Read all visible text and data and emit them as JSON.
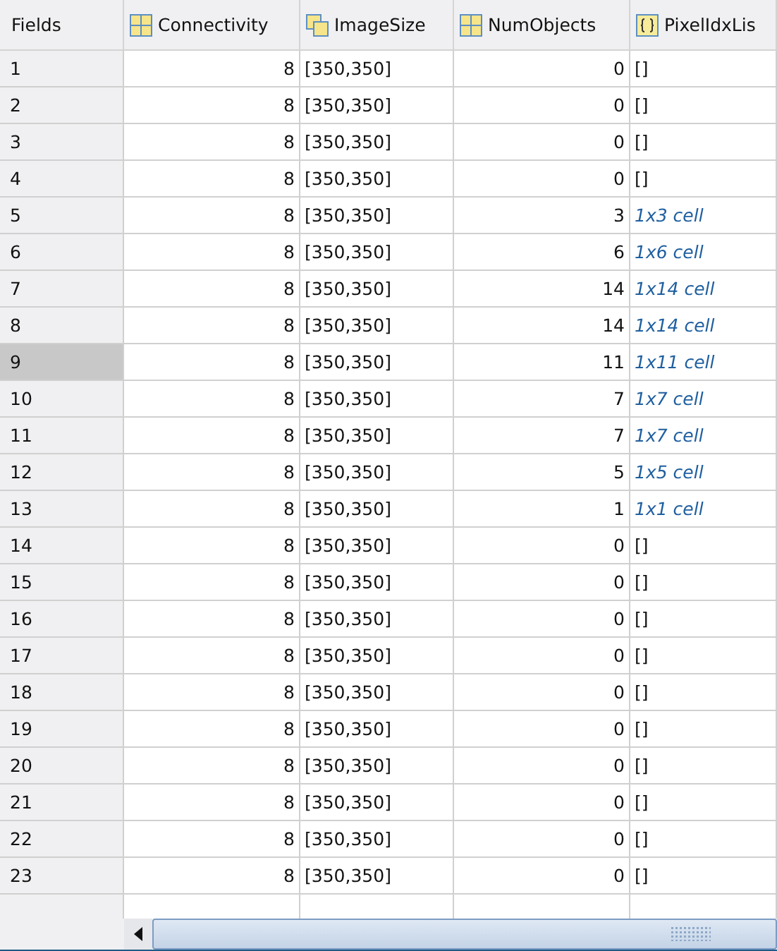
{
  "columns": [
    {
      "label": "Fields",
      "kind": "plain"
    },
    {
      "label": "Connectivity",
      "kind": "matrix"
    },
    {
      "label": "ImageSize",
      "kind": "stack"
    },
    {
      "label": "NumObjects",
      "kind": "matrix"
    },
    {
      "label": "PixelIdxLis",
      "kind": "cell"
    }
  ],
  "rows": [
    {
      "field": "1",
      "connectivity": "8",
      "image_size": "[350,350]",
      "num_objects": "0",
      "pixel_idx_list": "[]",
      "selected": false
    },
    {
      "field": "2",
      "connectivity": "8",
      "image_size": "[350,350]",
      "num_objects": "0",
      "pixel_idx_list": "[]",
      "selected": false
    },
    {
      "field": "3",
      "connectivity": "8",
      "image_size": "[350,350]",
      "num_objects": "0",
      "pixel_idx_list": "[]",
      "selected": false
    },
    {
      "field": "4",
      "connectivity": "8",
      "image_size": "[350,350]",
      "num_objects": "0",
      "pixel_idx_list": "[]",
      "selected": false
    },
    {
      "field": "5",
      "connectivity": "8",
      "image_size": "[350,350]",
      "num_objects": "3",
      "pixel_idx_list": "1x3 cell",
      "selected": false
    },
    {
      "field": "6",
      "connectivity": "8",
      "image_size": "[350,350]",
      "num_objects": "6",
      "pixel_idx_list": "1x6 cell",
      "selected": false
    },
    {
      "field": "7",
      "connectivity": "8",
      "image_size": "[350,350]",
      "num_objects": "14",
      "pixel_idx_list": "1x14 cell",
      "selected": false
    },
    {
      "field": "8",
      "connectivity": "8",
      "image_size": "[350,350]",
      "num_objects": "14",
      "pixel_idx_list": "1x14 cell",
      "selected": false
    },
    {
      "field": "9",
      "connectivity": "8",
      "image_size": "[350,350]",
      "num_objects": "11",
      "pixel_idx_list": "1x11 cell",
      "selected": true
    },
    {
      "field": "10",
      "connectivity": "8",
      "image_size": "[350,350]",
      "num_objects": "7",
      "pixel_idx_list": "1x7 cell",
      "selected": false
    },
    {
      "field": "11",
      "connectivity": "8",
      "image_size": "[350,350]",
      "num_objects": "7",
      "pixel_idx_list": "1x7 cell",
      "selected": false
    },
    {
      "field": "12",
      "connectivity": "8",
      "image_size": "[350,350]",
      "num_objects": "5",
      "pixel_idx_list": "1x5 cell",
      "selected": false
    },
    {
      "field": "13",
      "connectivity": "8",
      "image_size": "[350,350]",
      "num_objects": "1",
      "pixel_idx_list": "1x1 cell",
      "selected": false
    },
    {
      "field": "14",
      "connectivity": "8",
      "image_size": "[350,350]",
      "num_objects": "0",
      "pixel_idx_list": "[]",
      "selected": false
    },
    {
      "field": "15",
      "connectivity": "8",
      "image_size": "[350,350]",
      "num_objects": "0",
      "pixel_idx_list": "[]",
      "selected": false
    },
    {
      "field": "16",
      "connectivity": "8",
      "image_size": "[350,350]",
      "num_objects": "0",
      "pixel_idx_list": "[]",
      "selected": false
    },
    {
      "field": "17",
      "connectivity": "8",
      "image_size": "[350,350]",
      "num_objects": "0",
      "pixel_idx_list": "[]",
      "selected": false
    },
    {
      "field": "18",
      "connectivity": "8",
      "image_size": "[350,350]",
      "num_objects": "0",
      "pixel_idx_list": "[]",
      "selected": false
    },
    {
      "field": "19",
      "connectivity": "8",
      "image_size": "[350,350]",
      "num_objects": "0",
      "pixel_idx_list": "[]",
      "selected": false
    },
    {
      "field": "20",
      "connectivity": "8",
      "image_size": "[350,350]",
      "num_objects": "0",
      "pixel_idx_list": "[]",
      "selected": false
    },
    {
      "field": "21",
      "connectivity": "8",
      "image_size": "[350,350]",
      "num_objects": "0",
      "pixel_idx_list": "[]",
      "selected": false
    },
    {
      "field": "22",
      "connectivity": "8",
      "image_size": "[350,350]",
      "num_objects": "0",
      "pixel_idx_list": "[]",
      "selected": false
    },
    {
      "field": "23",
      "connectivity": "8",
      "image_size": "[350,350]",
      "num_objects": "0",
      "pixel_idx_list": "[]",
      "selected": false
    }
  ]
}
